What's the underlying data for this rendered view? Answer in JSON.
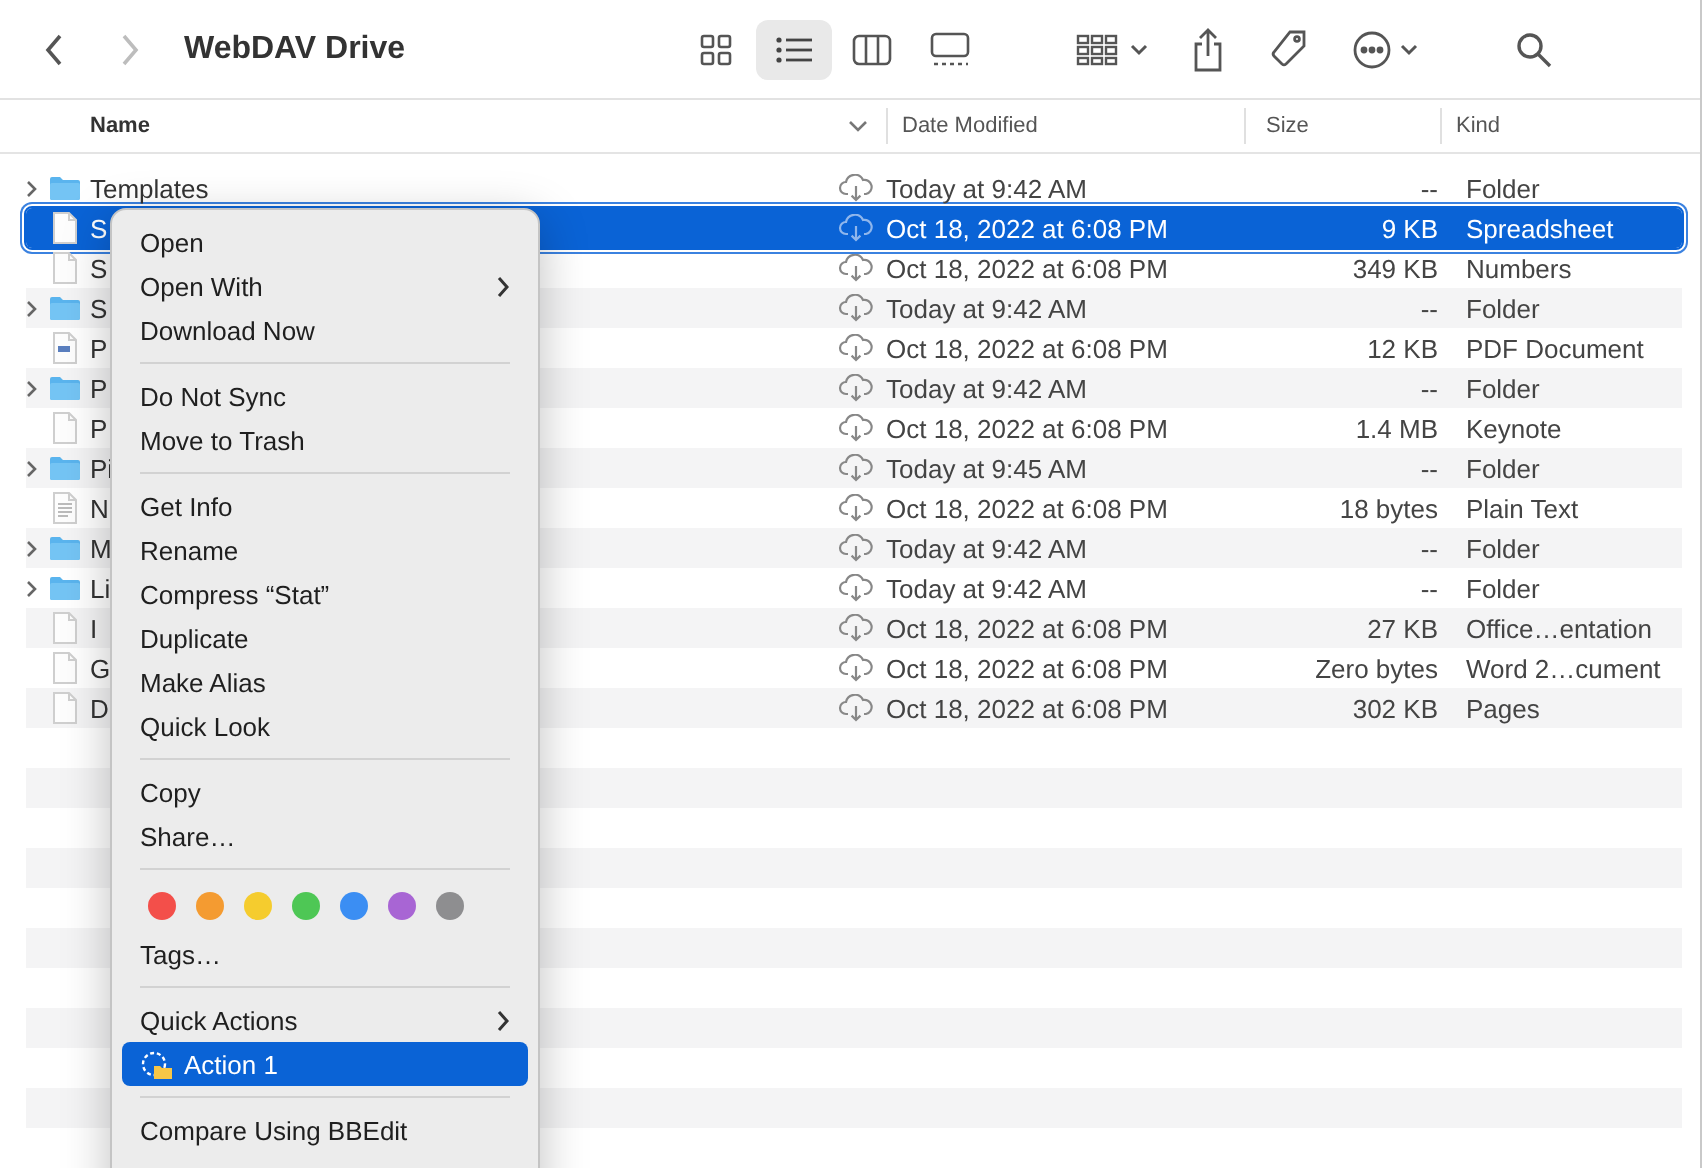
{
  "toolbar": {
    "title": "WebDAV Drive",
    "back": {
      "disabled": false
    },
    "forward": {
      "disabled": true
    },
    "view_modes": [
      {
        "kind": "icons",
        "selected": false
      },
      {
        "kind": "list",
        "selected": true
      },
      {
        "kind": "columns",
        "selected": false
      },
      {
        "kind": "gallery",
        "selected": false
      }
    ]
  },
  "columns": [
    {
      "label": "Name",
      "sorted": true
    },
    {
      "label": "Date Modified",
      "sorted": false
    },
    {
      "label": "Size",
      "sorted": false
    },
    {
      "label": "Kind",
      "sorted": false
    }
  ],
  "rows": [
    {
      "kind": "folder",
      "name": "Templates",
      "date": "Today at 9:42 AM",
      "size": "--",
      "file_kind": "Folder",
      "selected": false
    },
    {
      "kind": "document",
      "name": "S",
      "date": "Oct 18, 2022 at 6:08 PM",
      "size": "9 KB",
      "file_kind": "Spreadsheet",
      "selected": true
    },
    {
      "kind": "document",
      "name": "S",
      "date": "Oct 18, 2022 at 6:08 PM",
      "size": "349 KB",
      "file_kind": "Numbers",
      "selected": false
    },
    {
      "kind": "folder",
      "name": "S",
      "date": "Today at 9:42 AM",
      "size": "--",
      "file_kind": "Folder",
      "selected": false
    },
    {
      "kind": "pdf",
      "name": "P",
      "date": "Oct 18, 2022 at 6:08 PM",
      "size": "12 KB",
      "file_kind": "PDF Document",
      "selected": false
    },
    {
      "kind": "folder",
      "name": "P",
      "date": "Today at 9:42 AM",
      "size": "--",
      "file_kind": "Folder",
      "selected": false
    },
    {
      "kind": "document",
      "name": "P",
      "date": "Oct 18, 2022 at 6:08 PM",
      "size": "1.4 MB",
      "file_kind": "Keynote",
      "selected": false
    },
    {
      "kind": "folder",
      "name": "Pi",
      "date": "Today at 9:45 AM",
      "size": "--",
      "file_kind": "Folder",
      "selected": false
    },
    {
      "kind": "text",
      "name": "N",
      "date": "Oct 18, 2022 at 6:08 PM",
      "size": "18 bytes",
      "file_kind": "Plain Text",
      "selected": false
    },
    {
      "kind": "folder",
      "name": "M",
      "date": "Today at 9:42 AM",
      "size": "--",
      "file_kind": "Folder",
      "selected": false
    },
    {
      "kind": "folder",
      "name": "Li",
      "date": "Today at 9:42 AM",
      "size": "--",
      "file_kind": "Folder",
      "selected": false
    },
    {
      "kind": "document",
      "name": "I",
      "date": "Oct 18, 2022 at 6:08 PM",
      "size": "27 KB",
      "file_kind": "Office…entation",
      "selected": false
    },
    {
      "kind": "document",
      "name": "G",
      "date": "Oct 18, 2022 at 6:08 PM",
      "size": "Zero bytes",
      "file_kind": "Word 2…cument",
      "selected": false
    },
    {
      "kind": "document",
      "name": "D",
      "date": "Oct 18, 2022 at 6:08 PM",
      "size": "302 KB",
      "file_kind": "Pages",
      "selected": false
    }
  ],
  "context_menu": [
    {
      "kind": "item",
      "label": "Open",
      "submenu": false,
      "selected": false
    },
    {
      "kind": "item",
      "label": "Open With",
      "submenu": true,
      "selected": false
    },
    {
      "kind": "item",
      "label": "Download Now",
      "submenu": false,
      "selected": false
    },
    {
      "kind": "separator"
    },
    {
      "kind": "item",
      "label": "Do Not Sync",
      "submenu": false,
      "selected": false
    },
    {
      "kind": "item",
      "label": "Move to Trash",
      "submenu": false,
      "selected": false
    },
    {
      "kind": "separator"
    },
    {
      "kind": "item",
      "label": "Get Info",
      "submenu": false,
      "selected": false
    },
    {
      "kind": "item",
      "label": "Rename",
      "submenu": false,
      "selected": false
    },
    {
      "kind": "item",
      "label": "Compress “Stat”",
      "submenu": false,
      "selected": false
    },
    {
      "kind": "item",
      "label": "Duplicate",
      "submenu": false,
      "selected": false
    },
    {
      "kind": "item",
      "label": "Make Alias",
      "submenu": false,
      "selected": false
    },
    {
      "kind": "item",
      "label": "Quick Look",
      "submenu": false,
      "selected": false
    },
    {
      "kind": "separator"
    },
    {
      "kind": "item",
      "label": "Copy",
      "submenu": false,
      "selected": false
    },
    {
      "kind": "item",
      "label": "Share…",
      "submenu": false,
      "selected": false
    },
    {
      "kind": "separator"
    },
    {
      "kind": "tags",
      "colors": [
        {
          "color": "#f34f4a"
        },
        {
          "color": "#f49b31"
        },
        {
          "color": "#f5cc2e"
        },
        {
          "color": "#4ec755"
        },
        {
          "color": "#3b8ef3"
        },
        {
          "color": "#a865d4"
        },
        {
          "color": "#8e8e90"
        }
      ]
    },
    {
      "kind": "item",
      "label": "Tags…",
      "submenu": false,
      "selected": false
    },
    {
      "kind": "separator"
    },
    {
      "kind": "item",
      "label": "Quick Actions",
      "submenu": true,
      "selected": false
    },
    {
      "kind": "action",
      "label": "Action 1",
      "submenu": false,
      "selected": true
    },
    {
      "kind": "separator"
    },
    {
      "kind": "item",
      "label": "Compare Using BBEdit",
      "submenu": false,
      "selected": false
    }
  ]
}
